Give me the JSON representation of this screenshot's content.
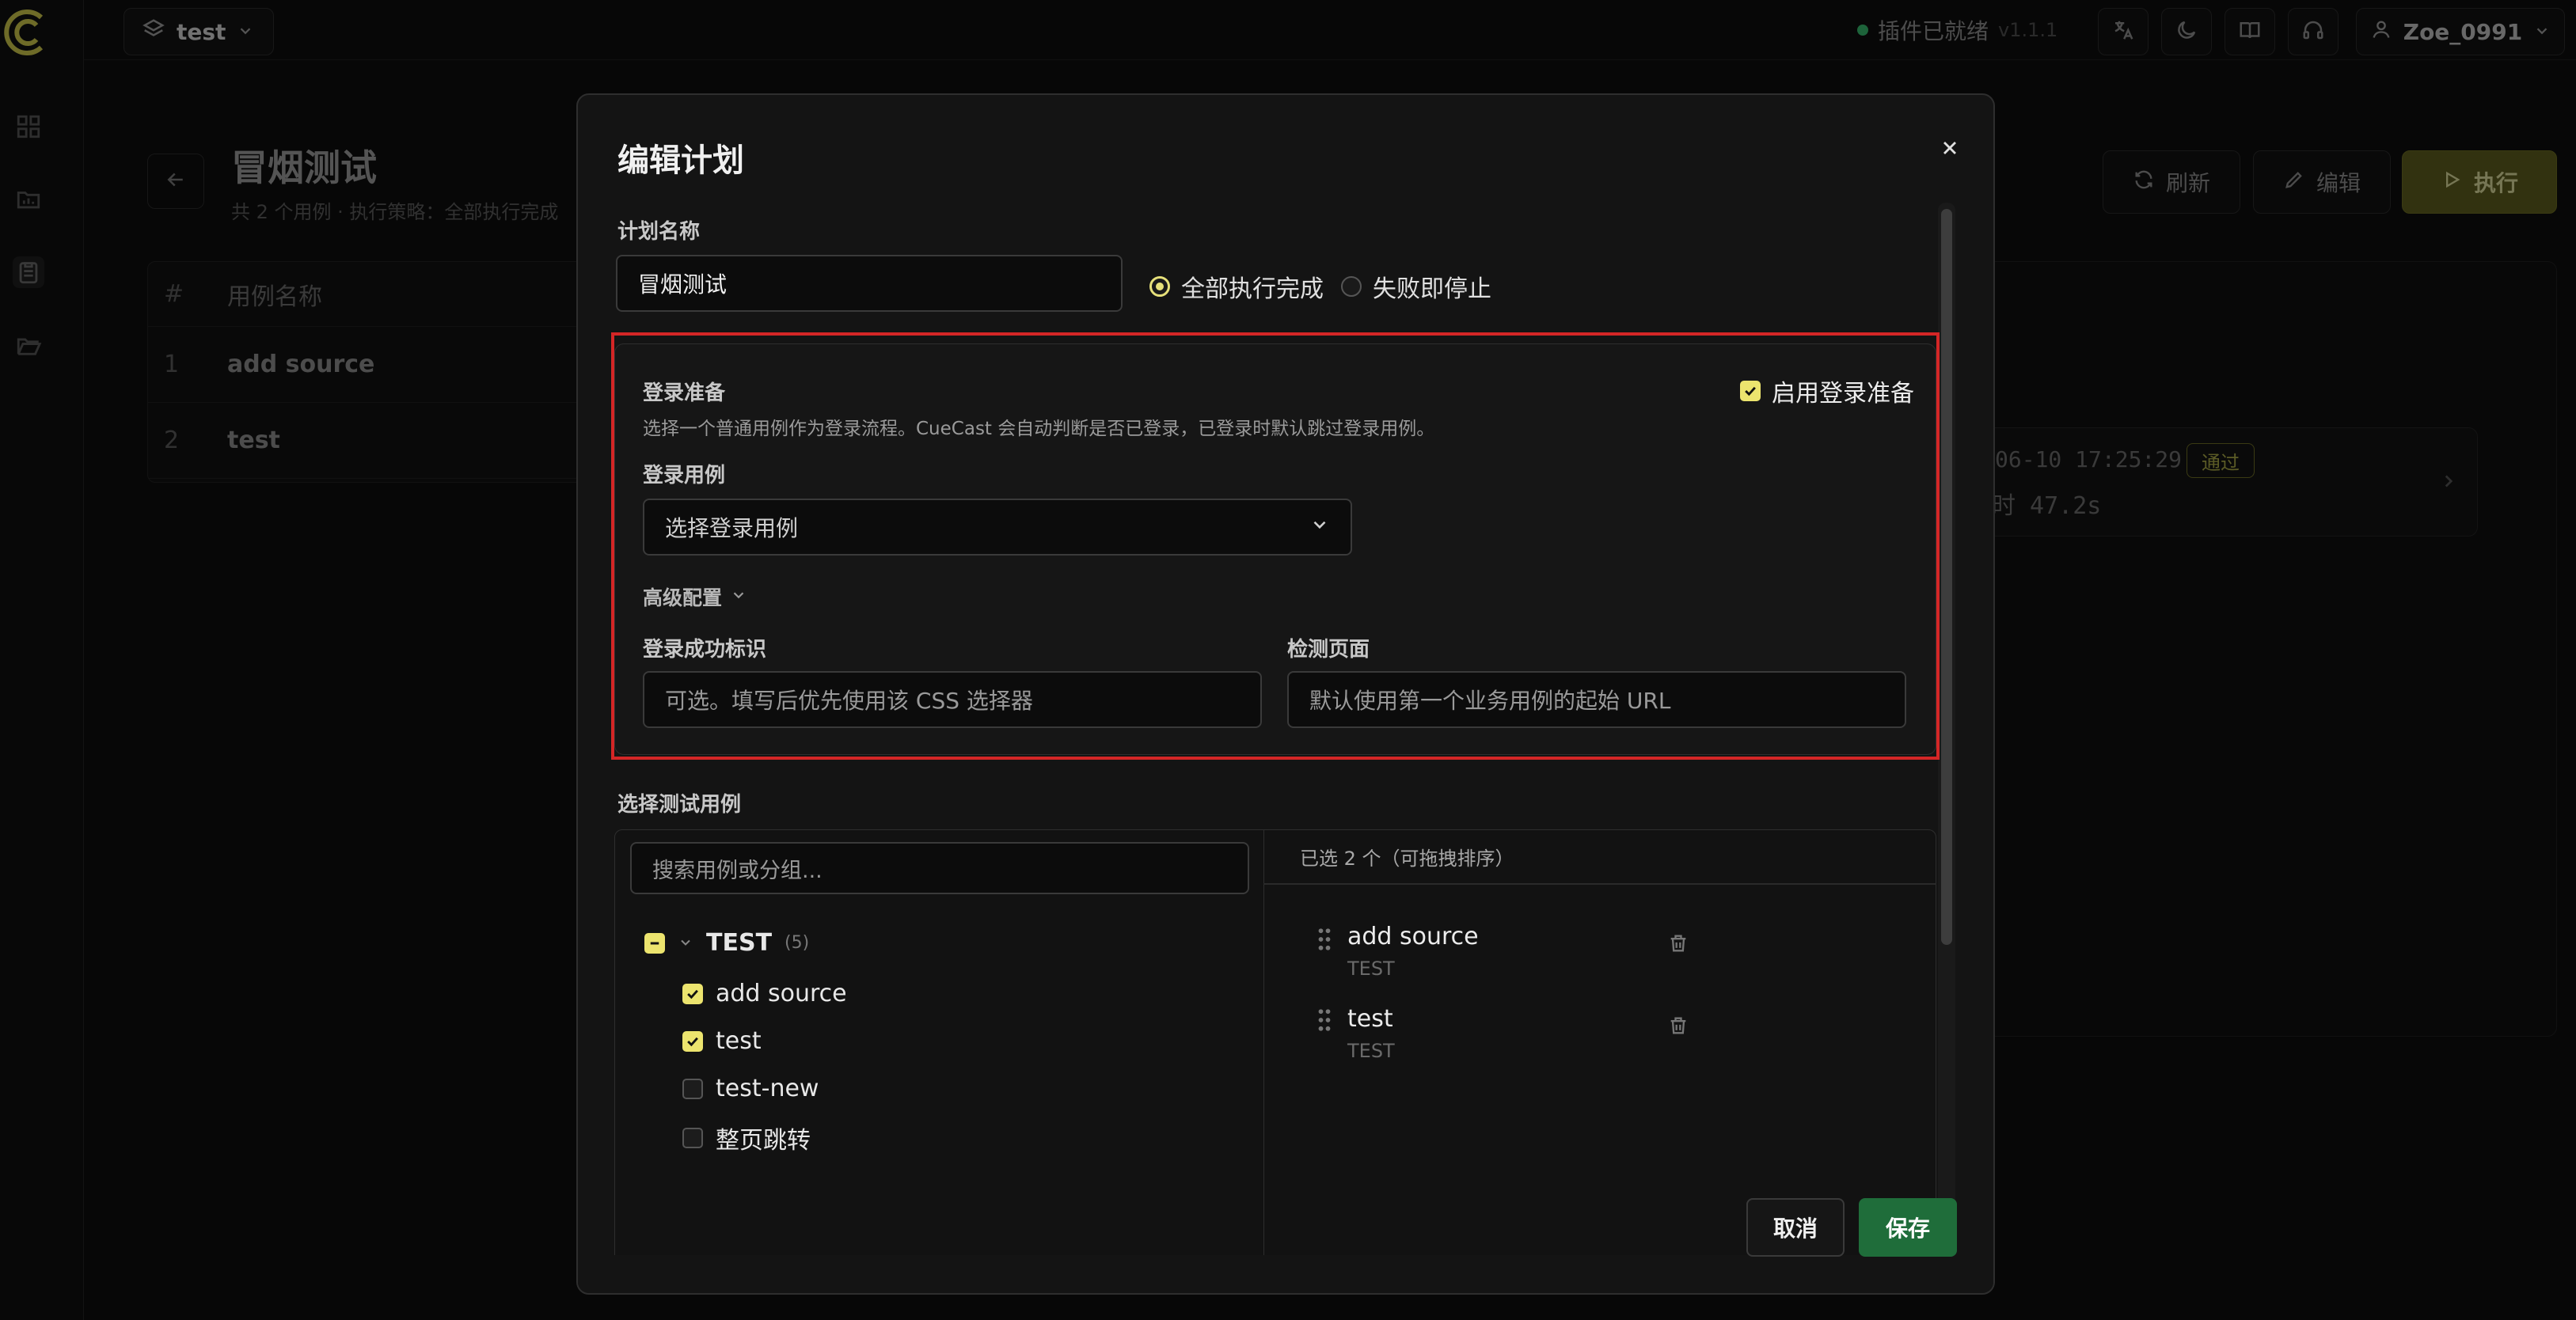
{
  "app": {
    "project_selector": "test",
    "status_text": "插件已就绪",
    "version": "v1.1.1",
    "user_name": "Zoe_0991"
  },
  "page": {
    "title": "冒烟测试",
    "subtitle": "共 2 个用例 · 执行策略：全部执行完成",
    "buttons": {
      "refresh": "刷新",
      "edit": "编辑",
      "run": "执行"
    },
    "table": {
      "headers": [
        "#",
        "用例名称"
      ],
      "rows": [
        {
          "index": "1",
          "name": "add source"
        },
        {
          "index": "2",
          "name": "test"
        }
      ]
    },
    "last_run": {
      "time": "06-10 17:25:29",
      "badge": "通过",
      "duration": "时 47.2s"
    }
  },
  "modal": {
    "title": "编辑计划",
    "plan_name_label": "计划名称",
    "plan_name_value": "冒烟测试",
    "strategy": {
      "options": [
        "全部执行完成",
        "失败即停止"
      ],
      "selected": "全部执行完成"
    },
    "login": {
      "section_title": "登录准备",
      "enable_label": "启用登录准备",
      "enabled": true,
      "description": "选择一个普通用例作为登录流程。CueCast 会自动判断是否已登录，已登录时默认跳过登录用例。",
      "case_label": "登录用例",
      "case_placeholder": "选择登录用例",
      "advanced_label": "高级配置",
      "success_marker_label": "登录成功标识",
      "success_marker_placeholder": "可选。填写后优先使用该 CSS 选择器",
      "check_page_label": "检测页面",
      "check_page_placeholder": "默认使用第一个业务用例的起始 URL"
    },
    "cases": {
      "section_title": "选择测试用例",
      "search_placeholder": "搜索用例或分组...",
      "group": {
        "name": "TEST",
        "count": "(5)"
      },
      "items": [
        {
          "name": "add source",
          "checked": true
        },
        {
          "name": "test",
          "checked": true
        },
        {
          "name": "test-new",
          "checked": false
        },
        {
          "name": "整页跳转",
          "checked": false
        }
      ],
      "selected_header": "已选 2 个（可拖拽排序）",
      "selected": [
        {
          "name": "add source",
          "group": "TEST"
        },
        {
          "name": "test",
          "group": "TEST"
        }
      ]
    },
    "cancel_label": "取消",
    "save_label": "保存"
  },
  "colors": {
    "accent_yellow": "#ece46e",
    "save_green": "#1f6d3a",
    "highlight_red": "#d42626",
    "status_green": "#35b56a"
  }
}
